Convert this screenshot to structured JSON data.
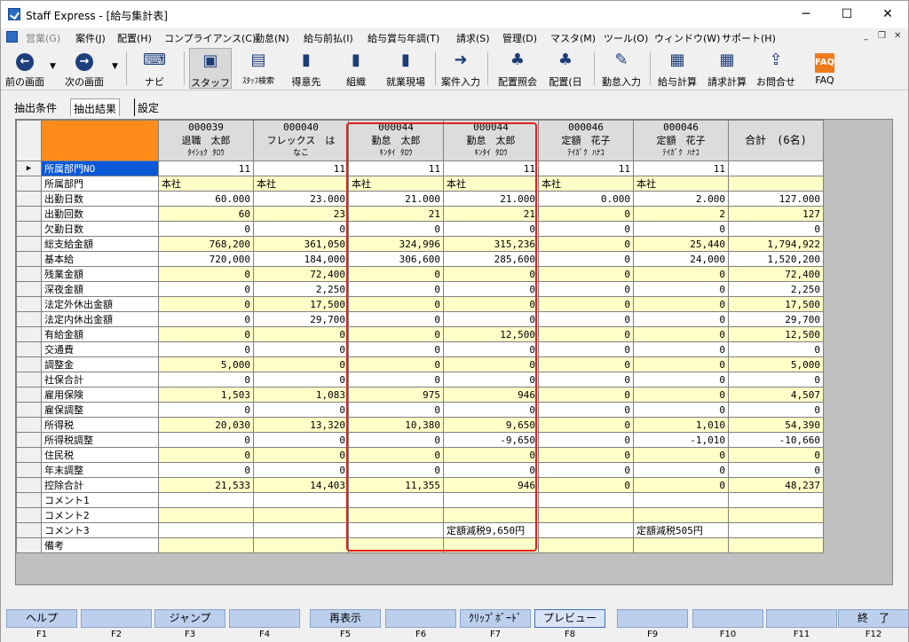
{
  "window": {
    "title": "Staff Express - [給与集計表]"
  },
  "menu": [
    "営業(G)",
    "案件(J)",
    "配置(H)",
    "コンプライアンス(C)",
    "勤怠(N)",
    "給与前払(I)",
    "給与賞与年調(T)",
    "請求(S)",
    "管理(D)",
    "マスタ(M)",
    "ツール(O)",
    "ウィンドウ(W)",
    "サポート(H)"
  ],
  "toolbar": [
    "前の画面",
    "次の画面",
    "ナビ",
    "スタッフ",
    "ｽﾀｯﾌ検索",
    "得意先",
    "組織",
    "就業現場",
    "案件入力",
    "配置照会",
    "配置(日",
    "勤怠入力",
    "給与計算",
    "請求計算",
    "お問合せ",
    "FAQ"
  ],
  "tabs": [
    "抽出条件",
    "抽出結果",
    "設定"
  ],
  "columns": [
    {
      "code": "000039",
      "name": "退職　太郎",
      "kana": "ﾀｲｼｮｸ ﾀﾛｳ"
    },
    {
      "code": "000040",
      "name": "フレックス　は",
      "kana": "なこ"
    },
    {
      "code": "000044",
      "name": "勤怠　太郎",
      "kana": "ｷﾝﾀｲ ﾀﾛｳ"
    },
    {
      "code": "000044",
      "name": "勤怠　太郎",
      "kana": "ｷﾝﾀｲ ﾀﾛｳ"
    },
    {
      "code": "000046",
      "name": "定額　花子",
      "kana": "ﾃｲｶﾞｸ ﾊﾅｺ"
    },
    {
      "code": "000046",
      "name": "定額　花子",
      "kana": "ﾃｲｶﾞｸ ﾊﾅｺ"
    }
  ],
  "total_header": "合計　(6名)",
  "rows": [
    {
      "label": "所属部門NO",
      "values": [
        "11",
        "11",
        "11",
        "11",
        "11",
        "11"
      ],
      "total": ""
    },
    {
      "label": "所属部門",
      "values": [
        "本社",
        "本社",
        "本社",
        "本社",
        "本社",
        "本社"
      ],
      "total": ""
    },
    {
      "label": "出勤日数",
      "values": [
        "60.000",
        "23.000",
        "21.000",
        "21.000",
        "0.000",
        "2.000"
      ],
      "total": "127.000"
    },
    {
      "label": "出勤回数",
      "values": [
        "60",
        "23",
        "21",
        "21",
        "0",
        "2"
      ],
      "total": "127"
    },
    {
      "label": "欠勤日数",
      "values": [
        "0",
        "0",
        "0",
        "0",
        "0",
        "0"
      ],
      "total": "0"
    },
    {
      "label": "総支給金額",
      "values": [
        "768,200",
        "361,050",
        "324,996",
        "315,236",
        "0",
        "25,440"
      ],
      "total": "1,794,922"
    },
    {
      "label": "基本給",
      "values": [
        "720,000",
        "184,000",
        "306,600",
        "285,600",
        "0",
        "24,000"
      ],
      "total": "1,520,200"
    },
    {
      "label": "残業金額",
      "values": [
        "0",
        "72,400",
        "0",
        "0",
        "0",
        "0"
      ],
      "total": "72,400"
    },
    {
      "label": "深夜金額",
      "values": [
        "0",
        "2,250",
        "0",
        "0",
        "0",
        "0"
      ],
      "total": "2,250"
    },
    {
      "label": "法定外休出金額",
      "values": [
        "0",
        "17,500",
        "0",
        "0",
        "0",
        "0"
      ],
      "total": "17,500"
    },
    {
      "label": "法定内休出金額",
      "values": [
        "0",
        "29,700",
        "0",
        "0",
        "0",
        "0"
      ],
      "total": "29,700"
    },
    {
      "label": "有給金額",
      "values": [
        "0",
        "0",
        "0",
        "12,500",
        "0",
        "0"
      ],
      "total": "12,500"
    },
    {
      "label": "交通費",
      "values": [
        "0",
        "0",
        "0",
        "0",
        "0",
        "0"
      ],
      "total": "0"
    },
    {
      "label": "調整金",
      "values": [
        "5,000",
        "0",
        "0",
        "0",
        "0",
        "0"
      ],
      "total": "5,000"
    },
    {
      "label": "社保合計",
      "values": [
        "0",
        "0",
        "0",
        "0",
        "0",
        "0"
      ],
      "total": "0"
    },
    {
      "label": "雇用保険",
      "values": [
        "1,503",
        "1,083",
        "975",
        "946",
        "0",
        "0"
      ],
      "total": "4,507"
    },
    {
      "label": "雇保調整",
      "values": [
        "0",
        "0",
        "0",
        "0",
        "0",
        "0"
      ],
      "total": "0"
    },
    {
      "label": "所得税",
      "values": [
        "20,030",
        "13,320",
        "10,380",
        "9,650",
        "0",
        "1,010"
      ],
      "total": "54,390"
    },
    {
      "label": "所得税調整",
      "values": [
        "0",
        "0",
        "0",
        "-9,650",
        "0",
        "-1,010"
      ],
      "total": "-10,660"
    },
    {
      "label": "住民税",
      "values": [
        "0",
        "0",
        "0",
        "0",
        "0",
        "0"
      ],
      "total": "0"
    },
    {
      "label": "年末調整",
      "values": [
        "0",
        "0",
        "0",
        "0",
        "0",
        "0"
      ],
      "total": "0"
    },
    {
      "label": "控除合計",
      "values": [
        "21,533",
        "14,403",
        "11,355",
        "946",
        "0",
        "0"
      ],
      "total": "48,237"
    },
    {
      "label": "コメント1",
      "values": [
        "",
        "",
        "",
        "",
        "",
        ""
      ],
      "total": ""
    },
    {
      "label": "コメント2",
      "values": [
        "",
        "",
        "",
        "",
        "",
        ""
      ],
      "total": ""
    },
    {
      "label": "コメント3",
      "values": [
        "",
        "",
        "",
        "定額減税9,650円",
        "",
        "定額減税505円"
      ],
      "total": ""
    },
    {
      "label": "備考",
      "values": [
        "",
        "",
        "",
        "",
        "",
        ""
      ],
      "total": ""
    }
  ],
  "fkeys": [
    {
      "label": "ヘルプ",
      "key": "F1"
    },
    {
      "label": "",
      "key": "F2"
    },
    {
      "label": "ジャンプ",
      "key": "F3"
    },
    {
      "label": "",
      "key": "F4"
    },
    {
      "label": "再表示",
      "key": "F5"
    },
    {
      "label": "",
      "key": "F6"
    },
    {
      "label": "ｸﾘｯﾌﾟﾎﾞｰﾄﾞ",
      "key": "F7"
    },
    {
      "label": "プレビュー",
      "key": "F8"
    },
    {
      "label": "",
      "key": "F9"
    },
    {
      "label": "",
      "key": "F10"
    },
    {
      "label": "",
      "key": "F11"
    },
    {
      "label": "終　了",
      "key": "F12"
    }
  ],
  "colors": {
    "label_header": "#ff8c1a",
    "row_highlight": "#ffffc8",
    "selected_cell": "#0a58d8",
    "annotation_box": "#e02020"
  }
}
